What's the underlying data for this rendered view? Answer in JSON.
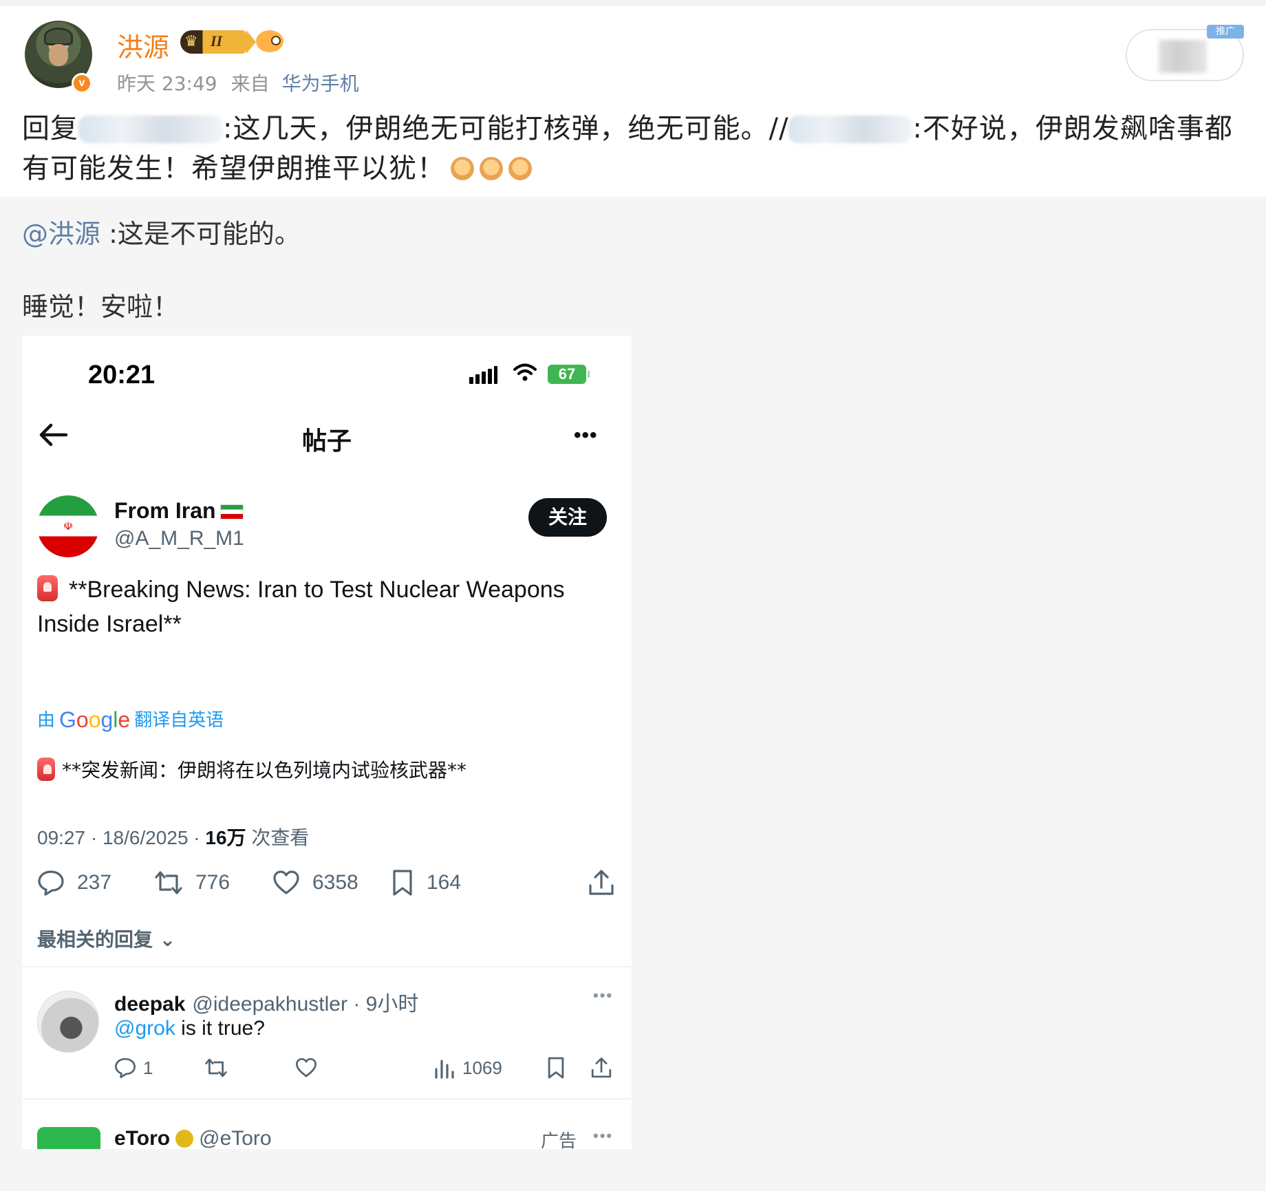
{
  "post": {
    "username": "洪源",
    "vip_level": "II",
    "time": "昨天 23:49",
    "from_label": "来自",
    "source": "华为手机",
    "ad_tag": "推广",
    "reply_prefix": "回复",
    "reply_part1": ":这几天，伊朗绝无可能打核弹，绝无可能。//",
    "reply_part2": ":不好说，伊朗发飙啥事都有可能发生！希望伊朗推平以犹！"
  },
  "repost": {
    "mention": "@洪源",
    "text": " :这是不可能的。",
    "line2": "睡觉！安啦！"
  },
  "screenshot": {
    "status_time": "20:21",
    "battery": "67",
    "nav_title": "帖子",
    "author_name": "From Iran",
    "author_handle": "@A_M_R_M1",
    "follow_label": "关注",
    "tweet_en": "**Breaking News: Iran to Test Nuclear Weapons Inside Israel**",
    "translated_prefix": "由",
    "translated_suffix": "翻译自英语",
    "tweet_zh": "**突发新闻：伊朗将在以色列境内试验核武器**",
    "time": "09:27 · 18/6/2025 · ",
    "views_count": "16万",
    "views_label": " 次查看",
    "replies": "237",
    "retweets": "776",
    "likes": "6358",
    "bookmarks": "164",
    "sort_label": "最相关的回复",
    "reply": {
      "name": "deepak",
      "handle": "@ideepakhustler",
      "time": " · 9小时",
      "mention": "@grok",
      "text": " is it true?",
      "replies": "1",
      "views": "1069"
    },
    "ad": {
      "name": "eToro",
      "handle": "@eToro",
      "label": "广告"
    }
  },
  "colors": {
    "username": "#f57f17",
    "link": "#5f7fa6",
    "twitter_blue": "#1d9bf0"
  }
}
